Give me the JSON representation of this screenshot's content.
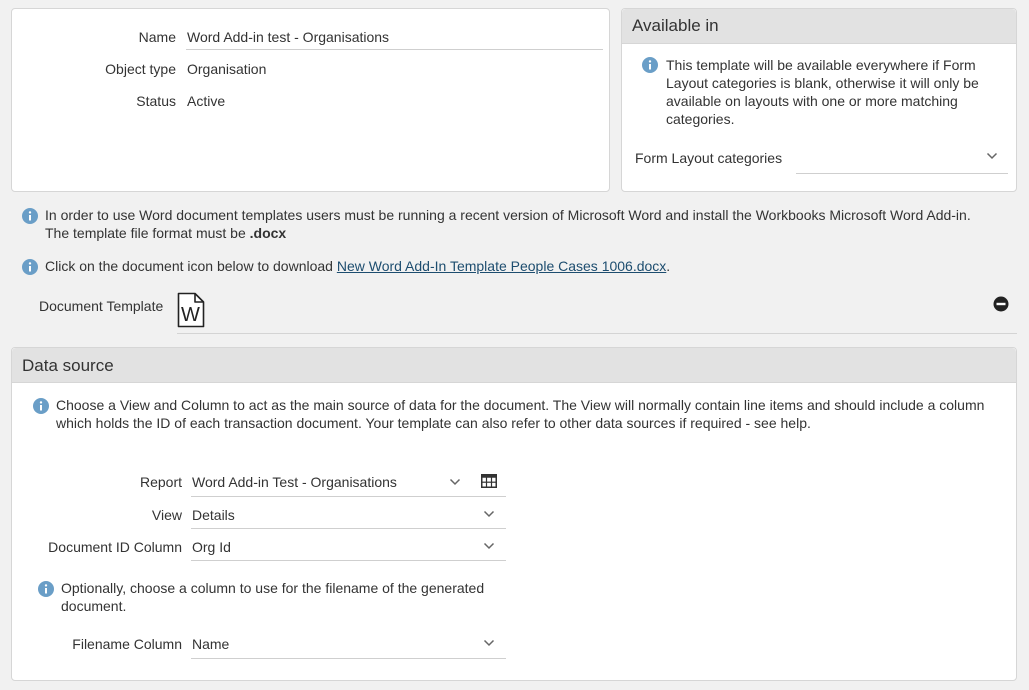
{
  "details": {
    "name_label": "Name",
    "name_value": "Word Add-in test - Organisations",
    "object_type_label": "Object type",
    "object_type_value": "Organisation",
    "status_label": "Status",
    "status_value": "Active"
  },
  "available_in": {
    "title": "Available in",
    "info_text": "This template will be available everywhere if Form Layout categories is blank, otherwise it will only be available on layouts with one or more matching categories.",
    "categories_label": "Form Layout categories",
    "categories_value": ""
  },
  "notes": {
    "word_note_1": "In order to use Word document templates users must be running a recent version of Microsoft Word and install the Workbooks Microsoft Word Add-in.",
    "word_note_2_prefix": "The template file format must be ",
    "word_note_2_bold": ".docx",
    "download_prefix": "Click on the document icon below to download ",
    "download_link": "New Word Add-In Template People Cases 1006.docx",
    "download_suffix": "."
  },
  "document_template": {
    "label": "Document Template",
    "icon": "word-document-icon",
    "icon_letter": "W",
    "remove_icon": "minus-circle-icon"
  },
  "data_source": {
    "title": "Data source",
    "info_text": "Choose a View and Column to act as the main source of data for the document. The View will normally contain line items and should include a column which holds the ID of each transaction document. Your template can also refer to other data sources if required - see help.",
    "report_label": "Report",
    "report_value": "Word Add-in Test - Organisations",
    "view_label": "View",
    "view_value": "Details",
    "doc_id_label": "Document ID Column",
    "doc_id_value": "Org Id",
    "filename_info": "Optionally, choose a column to use for the filename of the generated document.",
    "filename_label": "Filename Column",
    "filename_value": "Name"
  },
  "colors": {
    "info_icon": "#6a9ec7",
    "link": "#1d4d6f",
    "header_bg": "#e2e2e2"
  }
}
